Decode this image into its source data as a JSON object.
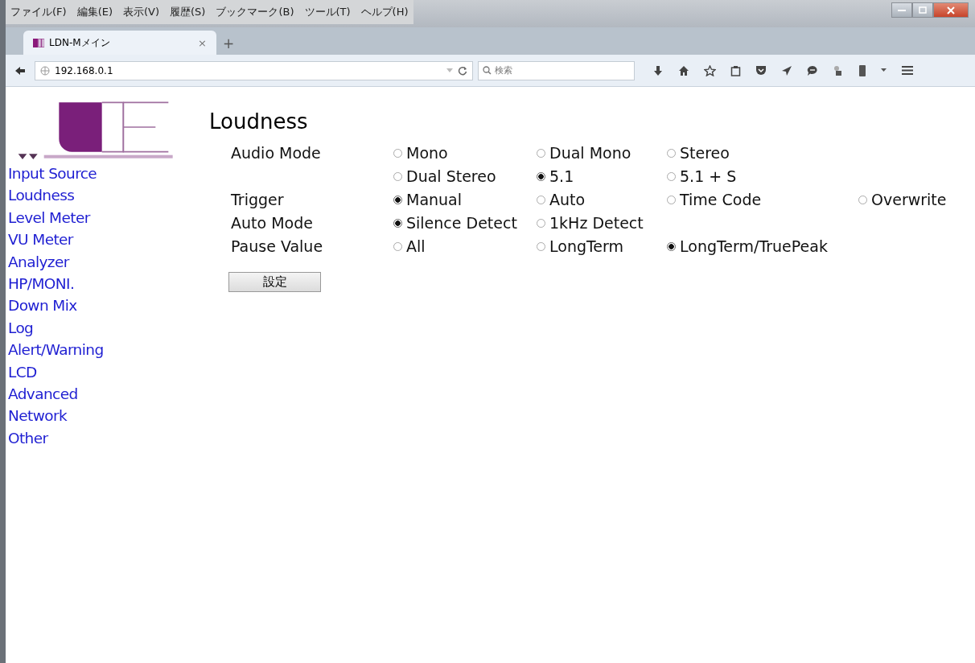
{
  "menu_bar": [
    "ファイル(F)",
    "編集(E)",
    "表示(V)",
    "履歴(S)",
    "ブックマーク(B)",
    "ツール(T)",
    "ヘルプ(H)"
  ],
  "tabs": [
    {
      "title": "LDN-Mメイン",
      "close": "×",
      "selected": true
    }
  ],
  "new_tab": "+",
  "address_bar": {
    "url": "192.168.0.1"
  },
  "search": {
    "placeholder": "検索"
  },
  "sidebar": {
    "items": [
      "Input Source",
      "Loudness",
      "Level Meter",
      "VU Meter",
      "Analyzer",
      "HP/MONI.",
      "Down Mix",
      "Log",
      "Alert/Warning",
      "LCD",
      "Advanced",
      "Network",
      "Other"
    ]
  },
  "page": {
    "title": "Loudness",
    "fields": [
      {
        "label": "Audio Mode",
        "rows": [
          [
            {
              "label": "Mono",
              "selected": false
            },
            {
              "label": "Dual Mono",
              "selected": false
            },
            {
              "label": "Stereo",
              "selected": false
            }
          ],
          [
            {
              "label": "Dual Stereo",
              "selected": false
            },
            {
              "label": "5.1",
              "selected": true
            },
            {
              "label": "5.1 + S",
              "selected": false
            }
          ]
        ]
      },
      {
        "label": "Trigger",
        "rows": [
          [
            {
              "label": "Manual",
              "selected": true
            },
            {
              "label": "Auto",
              "selected": false
            },
            {
              "label": "Time Code",
              "selected": false
            },
            {
              "label": "Overwrite",
              "selected": false
            }
          ]
        ]
      },
      {
        "label": "Auto Mode",
        "rows": [
          [
            {
              "label": "Silence Detect",
              "selected": true
            },
            {
              "label": "1kHz Detect",
              "selected": false
            }
          ]
        ]
      },
      {
        "label": "Pause Value",
        "rows": [
          [
            {
              "label": "All",
              "selected": false
            },
            {
              "label": "LongTerm",
              "selected": false
            },
            {
              "label": "LongTerm/TruePeak",
              "selected": true
            }
          ]
        ]
      }
    ],
    "submit": "設定"
  }
}
